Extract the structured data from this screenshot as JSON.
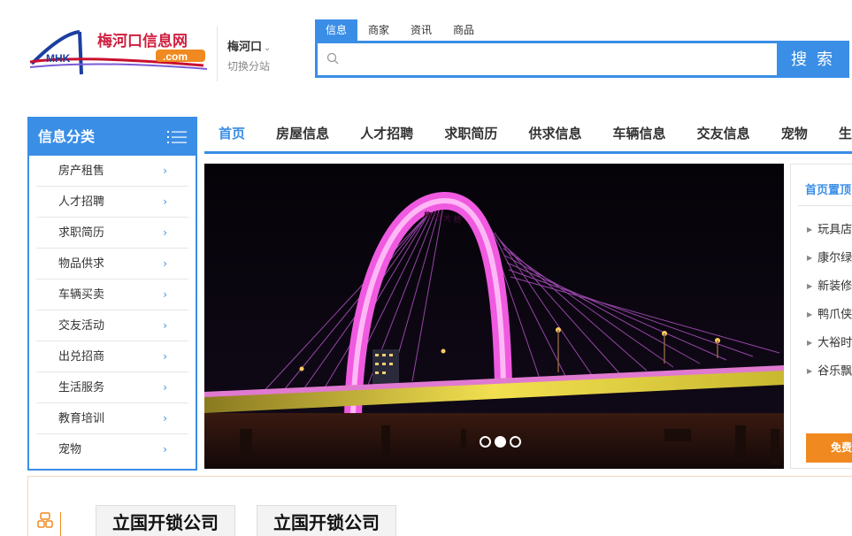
{
  "header": {
    "logo_text": "梅河口信息网",
    "logo_sub": ".com",
    "logo_letters": "MHK",
    "city": "梅河口",
    "switch_site": "切换分站"
  },
  "search": {
    "tabs": [
      "信息",
      "商家",
      "资讯",
      "商品"
    ],
    "active_tab": "信息",
    "placeholder": "",
    "button_label": "搜 索"
  },
  "category": {
    "title": "信息分类",
    "items": [
      {
        "label": "房产租售"
      },
      {
        "label": "人才招聘"
      },
      {
        "label": "求职简历"
      },
      {
        "label": "物品供求"
      },
      {
        "label": "车辆买卖"
      },
      {
        "label": "交友活动"
      },
      {
        "label": "出兑招商"
      },
      {
        "label": "生活服务"
      },
      {
        "label": "教育培训"
      },
      {
        "label": "宠物"
      }
    ]
  },
  "nav": {
    "items": [
      {
        "label": "首页"
      },
      {
        "label": "房屋信息"
      },
      {
        "label": "人才招聘"
      },
      {
        "label": "求职简历"
      },
      {
        "label": "供求信息"
      },
      {
        "label": "车辆信息"
      },
      {
        "label": "交友信息"
      },
      {
        "label": "宠物"
      },
      {
        "label": "生活"
      }
    ],
    "active_index": 0
  },
  "banner": {
    "arch_text": "梅 河 大 桥",
    "slide_count": 3,
    "active_slide": 2
  },
  "top_panel": {
    "title": "首页置顶",
    "items": [
      "玩具店",
      "康尔绿",
      "新装修",
      "鸭爪侠",
      "大裕时",
      "谷乐飘"
    ],
    "free_button": "免费"
  },
  "bottom": {
    "ads": [
      "立国开锁公司",
      "立国开锁公司"
    ]
  },
  "colors": {
    "accent": "#3a8ee6",
    "orange": "#f08a20"
  }
}
